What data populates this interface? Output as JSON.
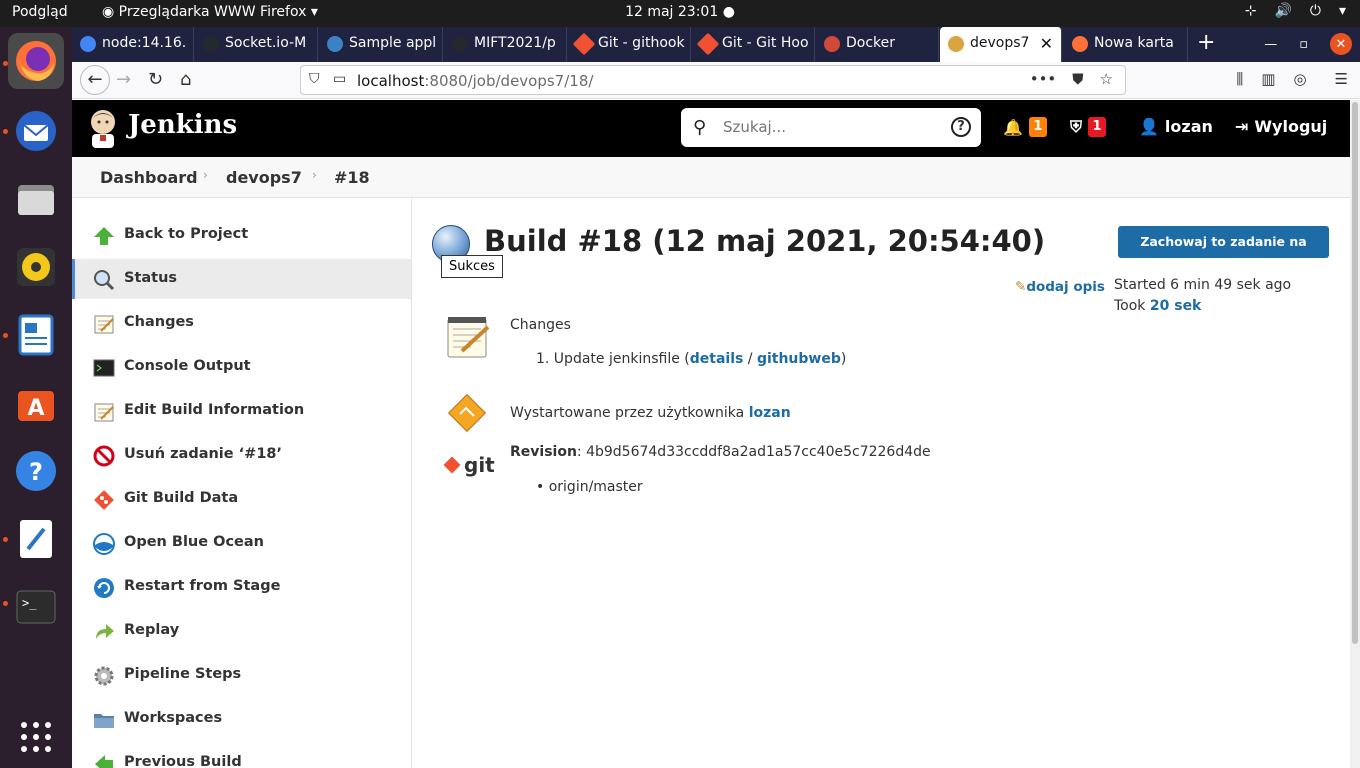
{
  "system": {
    "activities": "Podgląd",
    "app_name": "Przeglądarka WWW Firefox",
    "clock": "12 maj  23:01"
  },
  "tabs": [
    {
      "label": "node:14.16.",
      "icon_color": "#4285f4"
    },
    {
      "label": "Socket.io-M",
      "icon_color": "#24292e"
    },
    {
      "label": "Sample appl",
      "icon_color": "#3b82c4"
    },
    {
      "label": "MIFT2021/p",
      "icon_color": "#24292e"
    },
    {
      "label": "Git - githook",
      "icon_color": "#f05133"
    },
    {
      "label": "Git - Git Hoo",
      "icon_color": "#f05133"
    },
    {
      "label": "Docker",
      "icon_color": "#d24939"
    },
    {
      "label": "devops7",
      "icon_color": "#d9a441"
    },
    {
      "label": "Nowa karta",
      "icon_color": "#ff7139"
    }
  ],
  "url": {
    "host": "localhost",
    "rest": ":8080/job/devops7/18/"
  },
  "header": {
    "brand": "Jenkins",
    "search_placeholder": "Szukaj...",
    "notifications_count": "1",
    "security_count": "1",
    "user": "lozan",
    "logout": "Wyloguj",
    "notif_color": "#fe820a",
    "security_color": "#e41b23"
  },
  "breadcrumb": [
    "Dashboard",
    "devops7",
    "#18"
  ],
  "sidebar": {
    "items": [
      {
        "label": "Back to Project",
        "icon": "up-arrow-icon"
      },
      {
        "label": "Status",
        "icon": "magnifier-icon"
      },
      {
        "label": "Changes",
        "icon": "notepad-icon"
      },
      {
        "label": "Console Output",
        "icon": "terminal-icon"
      },
      {
        "label": "Edit Build Information",
        "icon": "notepad-icon"
      },
      {
        "label": "Usuń zadanie ‘#18’",
        "icon": "no-entry-icon"
      },
      {
        "label": "Git Build Data",
        "icon": "git-icon"
      },
      {
        "label": "Open Blue Ocean",
        "icon": "blue-ocean-icon"
      },
      {
        "label": "Restart from Stage",
        "icon": "refresh-icon"
      },
      {
        "label": "Replay",
        "icon": "replay-arrow-icon"
      },
      {
        "label": "Pipeline Steps",
        "icon": "gear-icon"
      },
      {
        "label": "Workspaces",
        "icon": "folder-icon"
      },
      {
        "label": "Previous Build",
        "icon": "left-arrow-icon"
      }
    ]
  },
  "build": {
    "title": "Build #18 (12 maj 2021, 20:54:40)",
    "status_tooltip": "Sukces",
    "keep_button": "Zachowaj to zadanie na zawsze",
    "add_description": "dodaj opis",
    "started": "Started 6 min 49 sek ago",
    "took_prefix": "Took ",
    "took_value": "20 sek",
    "changes_title": "Changes",
    "change_item_prefix": "1. Update jenkinsfile (",
    "change_details": "details",
    "change_sep": " / ",
    "change_githubweb": "githubweb",
    "change_suffix": ")",
    "started_by_prefix": "Wystartowane przez użytkownika ",
    "started_by_user": "lozan",
    "revision_label": "Revision",
    "revision_value": ": 4b9d5674d33ccddf8a2ad1a57cc40e5c7226d4de",
    "branch": "origin/master",
    "git_label": "git"
  }
}
